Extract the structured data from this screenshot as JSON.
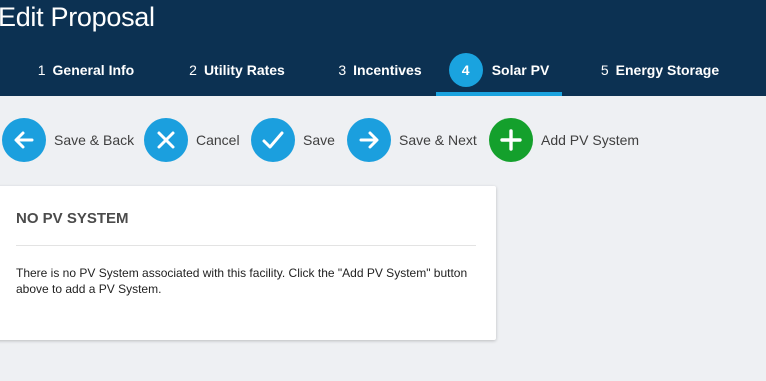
{
  "header": {
    "title": "Edit Proposal",
    "colors": {
      "background": "#0c3152",
      "accent": "#1aa3df"
    }
  },
  "tabs": [
    {
      "number": "1",
      "label": "General Info",
      "active": false
    },
    {
      "number": "2",
      "label": "Utility Rates",
      "active": false
    },
    {
      "number": "3",
      "label": "Incentives",
      "active": false
    },
    {
      "number": "4",
      "label": "Solar PV",
      "active": true
    },
    {
      "number": "5",
      "label": "Energy Storage",
      "active": false
    }
  ],
  "actions": [
    {
      "label": "Save & Back",
      "icon": "arrow-left-icon",
      "color": "#1b9fde"
    },
    {
      "label": "Cancel",
      "icon": "close-icon",
      "color": "#1b9fde"
    },
    {
      "label": "Save",
      "icon": "check-icon",
      "color": "#1b9fde"
    },
    {
      "label": "Save & Next",
      "icon": "arrow-right-icon",
      "color": "#1b9fde"
    },
    {
      "label": "Add PV System",
      "icon": "plus-icon",
      "color": "#14a02c"
    }
  ],
  "card": {
    "title": "NO PV SYSTEM",
    "message": "There is no PV System associated with this facility. Click the \"Add PV System\" button above to add a PV System."
  }
}
